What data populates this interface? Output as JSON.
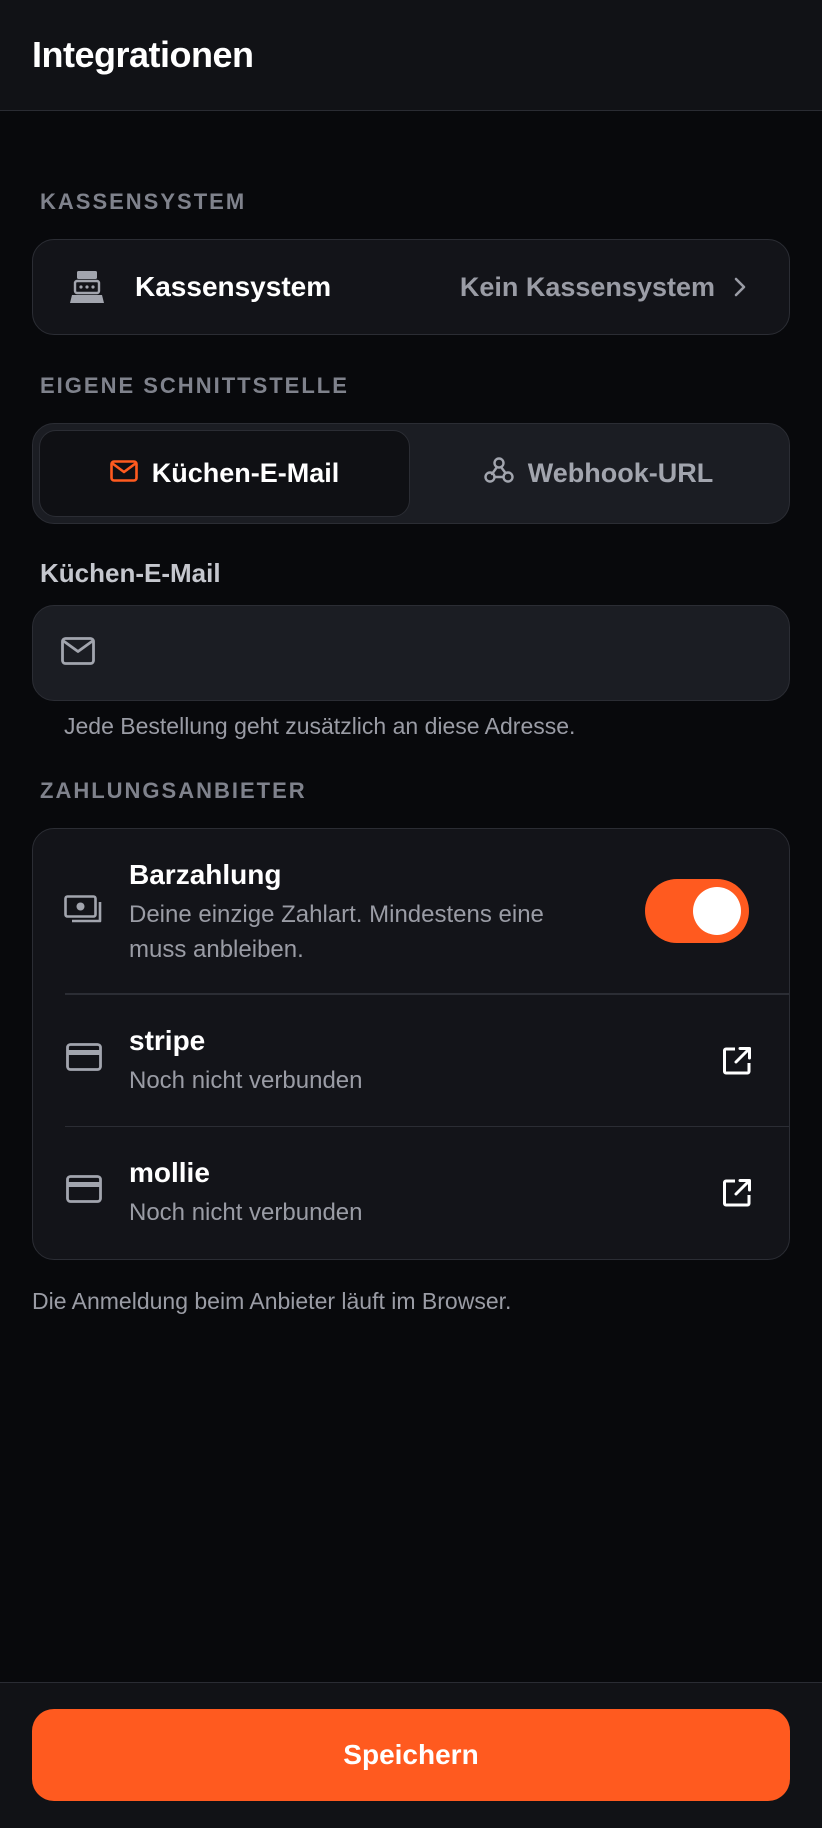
{
  "header": {
    "title": "Integrationen"
  },
  "pos_section": {
    "label": "KASSENSYSTEM",
    "row_title": "Kassensystem",
    "row_value": "Kein Kassensystem"
  },
  "interface_section": {
    "label": "EIGENE SCHNITTSTELLE",
    "tabs": [
      {
        "label": "Küchen-E-Mail",
        "active": true
      },
      {
        "label": "Webhook-URL",
        "active": false
      }
    ],
    "field_label": "Küchen-E-Mail",
    "field_value": "",
    "field_placeholder": "",
    "helper": "Jede Bestellung geht zusätzlich an diese Adresse."
  },
  "payment_section": {
    "label": "ZAHLUNGSANBIETER",
    "providers": [
      {
        "title": "Barzahlung",
        "subtitle": "Deine einzige Zahlart. Mindestens eine muss anbleiben.",
        "icon": "cash-icon",
        "enabled": true
      },
      {
        "title": "stripe",
        "subtitle": "Noch nicht verbunden",
        "icon": "credit-card-icon",
        "action_icon": "external-link-icon"
      },
      {
        "title": "mollie",
        "subtitle": "Noch nicht verbunden",
        "icon": "credit-card-icon",
        "action_icon": "external-link-icon"
      }
    ],
    "footnote": "Die Anmeldung beim Anbieter läuft im Browser."
  },
  "footer": {
    "save_label": "Speichern"
  },
  "colors": {
    "accent": "#ff5a1f",
    "background": "#08090c",
    "card": "#131419",
    "muted": "#9a9ca5"
  }
}
